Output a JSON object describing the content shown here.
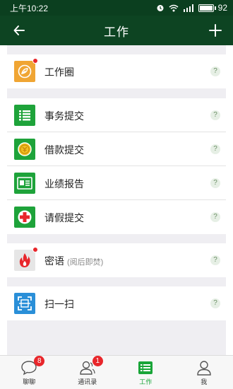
{
  "status_bar": {
    "time": "上午10:22",
    "battery": "92",
    "battery_level": 0.92
  },
  "header": {
    "title": "工作",
    "back_icon": "back-arrow-icon",
    "add_icon": "plus-icon"
  },
  "sections": {
    "circle": {
      "label": "工作圈",
      "help": "?"
    },
    "affairs": {
      "label": "事务提交",
      "help": "?"
    },
    "loan": {
      "label": "借款提交",
      "help": "?"
    },
    "report": {
      "label": "业绩报告",
      "help": "?"
    },
    "leave": {
      "label": "请假提交",
      "help": "?"
    },
    "secret": {
      "label": "密语",
      "sub": "(阅后即焚)",
      "help": "?"
    },
    "scan": {
      "label": "扫一扫",
      "help": "?"
    }
  },
  "tabs": {
    "chat": {
      "label": "聊聊",
      "badge": "8"
    },
    "contacts": {
      "label": "通讯录",
      "badge": "1"
    },
    "work": {
      "label": "工作"
    },
    "me": {
      "label": "我"
    }
  },
  "colors": {
    "header": "#0d4422",
    "status_bar": "#0b3f1f",
    "icon_green": "#1ea33a",
    "icon_orange": "#f0a533",
    "icon_blue": "#2a8fd8",
    "badge_red": "#e8262b",
    "active_tab": "#19a538"
  }
}
